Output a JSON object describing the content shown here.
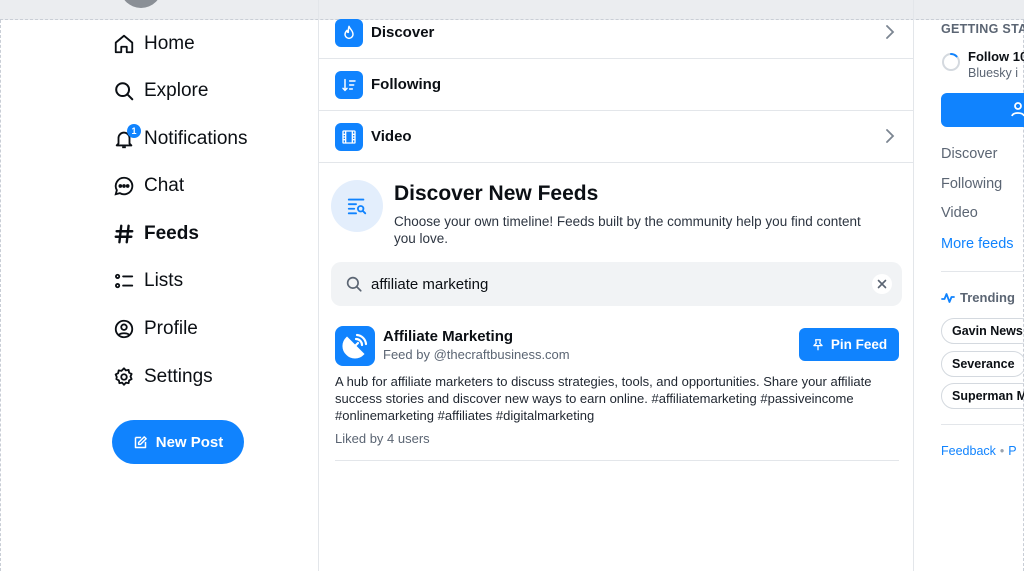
{
  "nav": {
    "items": [
      {
        "label": "Home",
        "icon": "home-icon"
      },
      {
        "label": "Explore",
        "icon": "search-icon"
      },
      {
        "label": "Notifications",
        "icon": "bell-icon",
        "badge": "1"
      },
      {
        "label": "Chat",
        "icon": "chat-bubble-icon"
      },
      {
        "label": "Feeds",
        "icon": "hash-icon",
        "active": true
      },
      {
        "label": "Lists",
        "icon": "list-icon"
      },
      {
        "label": "Profile",
        "icon": "user-circle-icon"
      },
      {
        "label": "Settings",
        "icon": "gear-icon"
      }
    ],
    "new_post_label": "New Post"
  },
  "feeds": {
    "rows": [
      {
        "label": "Discover",
        "icon": "flame-icon"
      },
      {
        "label": "Following",
        "icon": "sort-list-icon"
      },
      {
        "label": "Video",
        "icon": "film-icon"
      }
    ]
  },
  "discover": {
    "title": "Discover New Feeds",
    "subtitle": "Choose your own timeline! Feeds built by the community help you find content you love."
  },
  "search": {
    "value": "affiliate marketing"
  },
  "result": {
    "title": "Affiliate Marketing",
    "by": "Feed by @thecraftbusiness.com",
    "pin_label": "Pin Feed",
    "description": "A hub for affiliate marketers to discuss strategies, tools, and opportunities. Share your affiliate success stories and discover new ways to earn online. #affiliatemarketing #passiveincome #onlinemarketing #affiliates #digitalmarketing",
    "liked": "Liked by 4 users"
  },
  "right": {
    "getting_started": "GETTING STA",
    "task": "Follow 10",
    "task_sub": "Bluesky i",
    "links": [
      "Discover",
      "Following",
      "Video"
    ],
    "more_feeds": "More feeds",
    "trending_label": "Trending",
    "trending": [
      "Gavin News",
      "Severance",
      "Superman M"
    ],
    "feedback": "Feedback",
    "footer_more": "P"
  },
  "colors": {
    "accent": "#1083fe",
    "muted_text": "#5b6573",
    "border": "#e3e6ea"
  }
}
